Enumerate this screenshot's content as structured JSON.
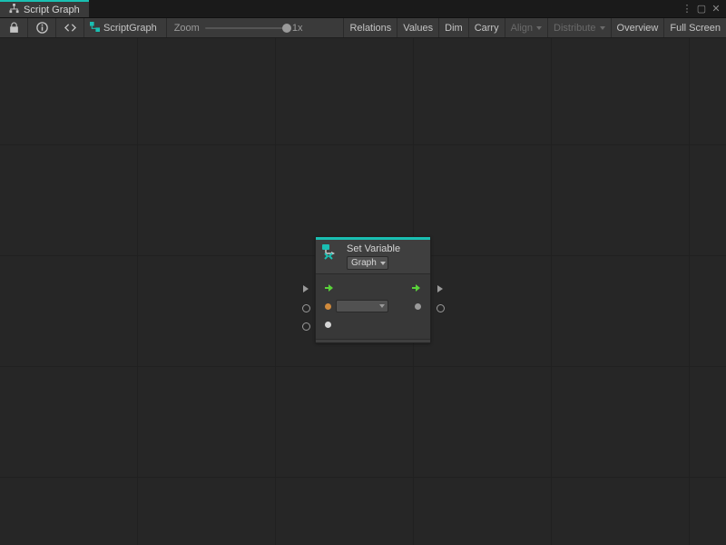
{
  "tab": {
    "title": "Script Graph"
  },
  "toolbar": {
    "breadcrumb": "ScriptGraph",
    "zoom_label": "Zoom",
    "zoom_value": "1x",
    "relations": "Relations",
    "values": "Values",
    "dim": "Dim",
    "carry": "Carry",
    "align": "Align",
    "distribute": "Distribute",
    "overview": "Overview",
    "fullscreen": "Full Screen"
  },
  "node": {
    "title": "Set Variable",
    "scope_label": "Graph",
    "name_value": ""
  },
  "colors": {
    "accent": "#1abfb2",
    "flow": "#5ad23a",
    "value_in": "#d08a3c"
  }
}
